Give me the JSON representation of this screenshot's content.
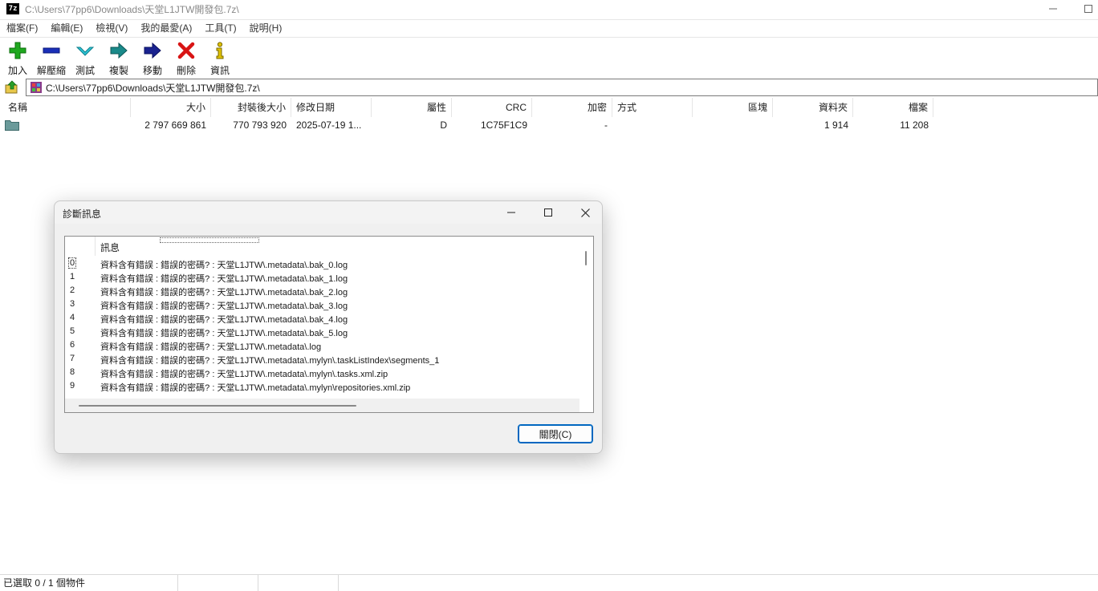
{
  "window": {
    "title": "C:\\Users\\77pp6\\Downloads\\天堂L1JTW開發包.7z\\",
    "app_icon": "7z"
  },
  "menu": [
    "檔案(F)",
    "編輯(E)",
    "檢視(V)",
    "我的最愛(A)",
    "工具(T)",
    "說明(H)"
  ],
  "toolbar": {
    "add": "加入",
    "extract": "解壓縮",
    "test": "測試",
    "copy": "複製",
    "move": "移動",
    "delete": "刪除",
    "info": "資訊"
  },
  "address": {
    "path": "C:\\Users\\77pp6\\Downloads\\天堂L1JTW開發包.7z\\"
  },
  "list": {
    "columns": [
      "名稱",
      "大小",
      "封裝後大小",
      "修改日期",
      "屬性",
      "CRC",
      "加密",
      "方式",
      "區塊",
      "資料夾",
      "檔案"
    ],
    "rows": [
      {
        "name": "",
        "size": "2 797 669 861",
        "packed": "770 793 920",
        "modified": "2025-07-19 1...",
        "attr": "D",
        "crc": "1C75F1C9",
        "encrypted": "-",
        "method": "",
        "block": "",
        "folders": "1 914",
        "files": "11 208"
      }
    ]
  },
  "status": {
    "selection": "已選取 0 / 1 個物件"
  },
  "dialog": {
    "title": "診斷訊息",
    "column_message": "訊息",
    "close_label": "關閉(C)",
    "messages": [
      {
        "num": "0",
        "text": "資料含有錯誤 : 錯誤的密碼? : 天堂L1JTW\\.metadata\\.bak_0.log"
      },
      {
        "num": "1",
        "text": "資料含有錯誤 : 錯誤的密碼? : 天堂L1JTW\\.metadata\\.bak_1.log"
      },
      {
        "num": "2",
        "text": "資料含有錯誤 : 錯誤的密碼? : 天堂L1JTW\\.metadata\\.bak_2.log"
      },
      {
        "num": "3",
        "text": "資料含有錯誤 : 錯誤的密碼? : 天堂L1JTW\\.metadata\\.bak_3.log"
      },
      {
        "num": "4",
        "text": "資料含有錯誤 : 錯誤的密碼? : 天堂L1JTW\\.metadata\\.bak_4.log"
      },
      {
        "num": "5",
        "text": "資料含有錯誤 : 錯誤的密碼? : 天堂L1JTW\\.metadata\\.bak_5.log"
      },
      {
        "num": "6",
        "text": "資料含有錯誤 : 錯誤的密碼? : 天堂L1JTW\\.metadata\\.log"
      },
      {
        "num": "7",
        "text": "資料含有錯誤 : 錯誤的密碼? : 天堂L1JTW\\.metadata\\.mylyn\\.taskListIndex\\segments_1"
      },
      {
        "num": "8",
        "text": "資料含有錯誤 : 錯誤的密碼? : 天堂L1JTW\\.metadata\\.mylyn\\.tasks.xml.zip"
      },
      {
        "num": "9",
        "text": "資料含有錯誤 : 錯誤的密碼? : 天堂L1JTW\\.metadata\\.mylyn\\repositories.xml.zip"
      }
    ]
  }
}
